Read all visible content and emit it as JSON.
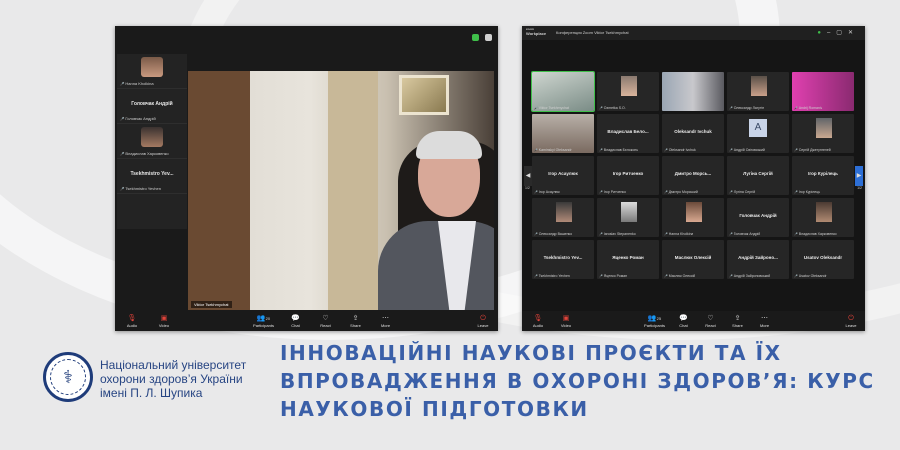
{
  "left_window": {
    "sidebar": [
      {
        "caption": "Hanna Kholkina",
        "center_name": ""
      },
      {
        "caption": "Головчак Андрій",
        "center_name": "Головчак Андрій"
      },
      {
        "caption": "Владислав Харковенко",
        "center_name": ""
      },
      {
        "caption": "Tsekhmistro Yevhen",
        "center_name": "Tsekhmistro Yev..."
      }
    ],
    "speaker_name": "Viktor Tsekhmychat",
    "toolbar": {
      "audio": "Audio",
      "video": "Video",
      "participants": "Participants",
      "participants_count": "20",
      "chat": "Chat",
      "react": "React",
      "share": "Share",
      "more": "More",
      "leave": "Leave"
    }
  },
  "right_window": {
    "app_name_line1": "zoom",
    "app_name_line2": "Workplace",
    "title": "Конференция Zoom Viktor Tsekhmychat",
    "page_left": "1/2",
    "page_right": "1/2",
    "tiles": [
      {
        "center_name": "",
        "caption": "Viktor Tsekhmychat",
        "avatar": ""
      },
      {
        "center_name": "",
        "caption": "Ozmetka S.O.",
        "avatar": ""
      },
      {
        "center_name": "",
        "caption": "",
        "avatar": ""
      },
      {
        "center_name": "",
        "caption": "Олександр Лагутін",
        "avatar": ""
      },
      {
        "center_name": "",
        "caption": "Andrij Romaniv",
        "avatar": ""
      },
      {
        "center_name": "",
        "caption": "Kaminskyi Oleksandr",
        "avatar": ""
      },
      {
        "center_name": "Владислав Бело...",
        "caption": "Владислав Бєлоконь",
        "avatar": ""
      },
      {
        "center_name": "Oleksandr Ivchuk",
        "caption": "Oleksandr Ivchuk",
        "avatar": ""
      },
      {
        "center_name": "",
        "caption": "Андрій Свіговський",
        "avatar": "A"
      },
      {
        "center_name": "",
        "caption": "Сергій Джегунгелей",
        "avatar": ""
      },
      {
        "center_name": "Ігор Асаулюк",
        "caption": "Ігор Асаулюк",
        "avatar": ""
      },
      {
        "center_name": "Ігор Ритченко",
        "caption": "Ігор Ритченко",
        "avatar": ""
      },
      {
        "center_name": "Дмитро Морсь...",
        "caption": "Дмитро Морський",
        "avatar": ""
      },
      {
        "center_name": "Лугіна Сергій",
        "caption": "Лугіна Сергій",
        "avatar": ""
      },
      {
        "center_name": "Ігор Курілець",
        "caption": "Ігор Курілець",
        "avatar": ""
      },
      {
        "center_name": "",
        "caption": "Олександр Вашенко",
        "avatar": ""
      },
      {
        "center_name": "",
        "caption": "Iaroslav Stepanenko",
        "avatar": ""
      },
      {
        "center_name": "",
        "caption": "Hanna Kholkina",
        "avatar": ""
      },
      {
        "center_name": "Головчак Андрій",
        "caption": "Головчак Андрій",
        "avatar": ""
      },
      {
        "center_name": "",
        "caption": "Владислав Харковенко",
        "avatar": ""
      },
      {
        "center_name": "Tsekhmistro Yev...",
        "caption": "Tsekhmistro Yevhen",
        "avatar": ""
      },
      {
        "center_name": "Яценко Роман",
        "caption": "Яценко Роман",
        "avatar": ""
      },
      {
        "center_name": "Маслюк Олексій",
        "caption": "Маслюк Олексій",
        "avatar": ""
      },
      {
        "center_name": "Андрій Зайроно...",
        "caption": "Андрій Зайроновський",
        "avatar": ""
      },
      {
        "center_name": "Usatov Oleksandr",
        "caption": "Usatov Oleksandr",
        "avatar": ""
      }
    ],
    "toolbar": {
      "audio": "Audio",
      "video": "Video",
      "participants": "Participants",
      "participants_count": "25",
      "chat": "Chat",
      "react": "React",
      "share": "Share",
      "more": "More",
      "leave": "Leave"
    }
  },
  "banner": {
    "university_line1": "Національний університет",
    "university_line2": "охорони здоров’я України",
    "university_line3": "імені П. Л. Шупика",
    "headline": "ІННОВАЦІЙНІ НАУКОВІ ПРОЄКТИ ТА ЇХ ВПРОВАДЖЕННЯ В ОХОРОНІ ЗДОРОВ’Я: КУРС НАУКОВОЇ ПІДГОТОВКИ"
  },
  "colors": {
    "headline": "#3a5fa8",
    "university": "#274583",
    "active_speaker": "#3fbf4a",
    "leave": "#e0433a"
  }
}
